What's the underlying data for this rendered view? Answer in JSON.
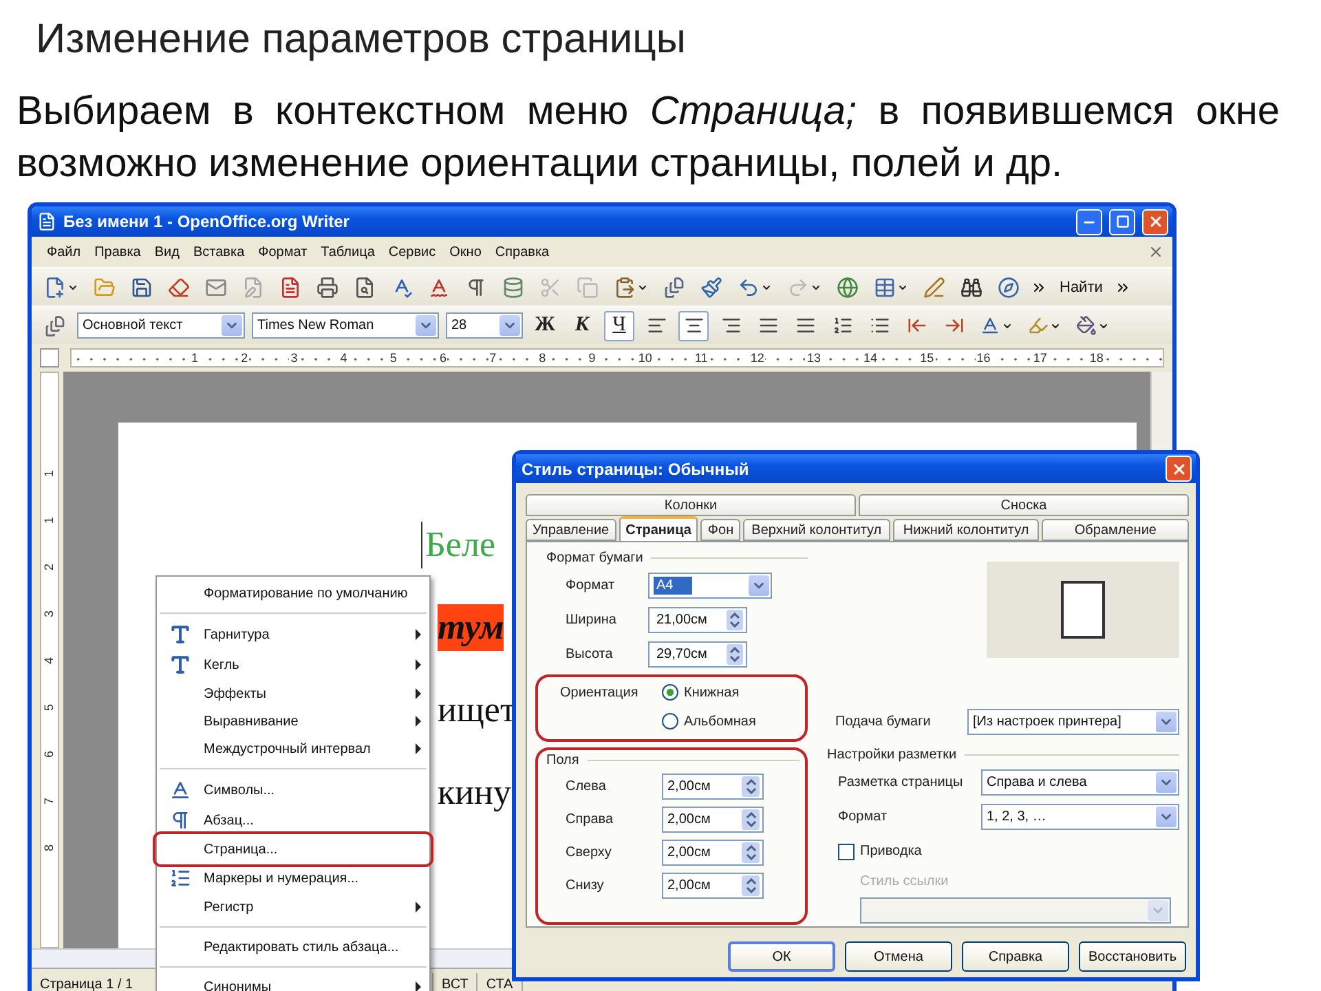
{
  "slide": {
    "title": "Изменение параметров страницы",
    "text": "Выбираем в контекстном меню *Страница;* в появившемся окне возможно изменение ориентации страницы, полей и др."
  },
  "window": {
    "title": "Без имени 1 - OpenOffice.org Writer"
  },
  "menu_bar": [
    "Файл",
    "Правка",
    "Вид",
    "Вставка",
    "Формат",
    "Таблица",
    "Сервис",
    "Окно",
    "Справка"
  ],
  "toolbar": {
    "find_button": "Найти"
  },
  "format_bar": {
    "style": "Основной текст",
    "font": "Times New Roman",
    "size": "28",
    "buttons": [
      {
        "label": "Ж",
        "kind": "bold",
        "pressed": false
      },
      {
        "label": "К",
        "kind": "italic",
        "pressed": false
      },
      {
        "label": "Ч",
        "kind": "underline",
        "pressed": true
      }
    ],
    "alignment": [
      {
        "kind": "left",
        "selected": false
      },
      {
        "kind": "center",
        "selected": true
      },
      {
        "kind": "right",
        "selected": false
      },
      {
        "kind": "justify",
        "selected": false
      }
    ]
  },
  "ruler": {
    "labels": [
      "1",
      "2",
      "3",
      "4",
      "5",
      "6",
      "7",
      "8",
      "9",
      "10",
      "11",
      "12",
      "13",
      "14",
      "15",
      "16",
      "17",
      "18"
    ]
  },
  "vertical_ruler": {
    "labels": [
      "1",
      "1",
      "2",
      "3",
      "4",
      "5",
      "6",
      "7",
      "8"
    ]
  },
  "document": {
    "lines": [
      {
        "text": "Беле",
        "kind": "heading"
      },
      {
        "text": "тум",
        "kind": "marked"
      },
      {
        "text": "ищет",
        "kind": "body"
      },
      {
        "text": "кину",
        "kind": "body"
      }
    ]
  },
  "context_menu": {
    "items": [
      {
        "kind": "item",
        "label": "Форматирование по умолчанию",
        "submenu": false,
        "highlighted": false
      },
      {
        "kind": "separator"
      },
      {
        "kind": "item",
        "label": "Гарнитура",
        "submenu": true,
        "highlighted": false
      },
      {
        "kind": "item",
        "label": "Кегль",
        "submenu": true,
        "highlighted": false
      },
      {
        "kind": "item",
        "label": "Эффекты",
        "submenu": true,
        "highlighted": false
      },
      {
        "kind": "item",
        "label": "Выравнивание",
        "submenu": true,
        "highlighted": false
      },
      {
        "kind": "item",
        "label": "Междустрочный интервал",
        "submenu": true,
        "highlighted": false
      },
      {
        "kind": "separator"
      },
      {
        "kind": "item",
        "label": "Символы...",
        "submenu": false,
        "highlighted": false
      },
      {
        "kind": "item",
        "label": "Абзац...",
        "submenu": false,
        "highlighted": false
      },
      {
        "kind": "item",
        "label": "Страница...",
        "submenu": false,
        "highlighted": true
      },
      {
        "kind": "item",
        "label": "Маркеры и нумерация...",
        "submenu": false,
        "highlighted": false
      },
      {
        "kind": "item",
        "label": "Регистр",
        "submenu": true,
        "highlighted": false
      },
      {
        "kind": "separator"
      },
      {
        "kind": "item",
        "label": "Редактировать стиль абзаца...",
        "submenu": false,
        "highlighted": false
      },
      {
        "kind": "separator"
      },
      {
        "kind": "item",
        "label": "Синонимы",
        "submenu": true,
        "highlighted": false
      }
    ]
  },
  "status_bar": [
    "Страница 1 / 1",
    "ВСТ",
    "СТА"
  ],
  "dialog": {
    "title": "Стиль страницы: Обычный",
    "tabs_top": [
      {
        "label": "Колонки",
        "selected": false
      },
      {
        "label": "Сноска",
        "selected": false
      }
    ],
    "tabs": [
      {
        "label": "Управление",
        "selected": false
      },
      {
        "label": "Страница",
        "selected": true
      },
      {
        "label": "Фон",
        "selected": false
      },
      {
        "label": "Верхний колонтитул",
        "selected": false
      },
      {
        "label": "Нижний колонтитул",
        "selected": false
      },
      {
        "label": "Обрамление",
        "selected": false
      }
    ],
    "paper": {
      "heading": "Формат бумаги",
      "fields": [
        {
          "label": "Формат",
          "value": "A4",
          "kind": "dropdown",
          "focused": true
        },
        {
          "label": "Ширина",
          "value": "21,00см",
          "kind": "spin",
          "focused": false
        },
        {
          "label": "Высота",
          "value": "29,70см",
          "kind": "spin",
          "focused": false
        }
      ],
      "orientation": {
        "label": "Ориентация",
        "highlighted": true,
        "options": [
          {
            "label": "Книжная",
            "selected": true
          },
          {
            "label": "Альбомная",
            "selected": false
          }
        ]
      },
      "source": {
        "label": "Подача бумаги",
        "value": "[Из настроек принтера]"
      }
    },
    "margins": {
      "heading": "Поля",
      "highlighted": true,
      "fields": [
        {
          "label": "Слева",
          "value": "2,00см"
        },
        {
          "label": "Справа",
          "value": "2,00см"
        },
        {
          "label": "Сверху",
          "value": "2,00см"
        },
        {
          "label": "Снизу",
          "value": "2,00см"
        }
      ]
    },
    "layout": {
      "heading": "Настройки разметки",
      "fields": [
        {
          "label": "Разметка страницы",
          "value": "Справа и слева"
        },
        {
          "label": "Формат",
          "value": "1, 2, 3, …"
        }
      ],
      "register": {
        "label": "Приводка",
        "checked": false
      },
      "reference": {
        "label": "Стиль ссылки",
        "disabled": true
      }
    },
    "buttons": [
      {
        "label": "ОК",
        "default": true
      },
      {
        "label": "Отмена",
        "default": false
      },
      {
        "label": "Справка",
        "default": false
      },
      {
        "label": "Восстановить",
        "default": false
      }
    ]
  }
}
